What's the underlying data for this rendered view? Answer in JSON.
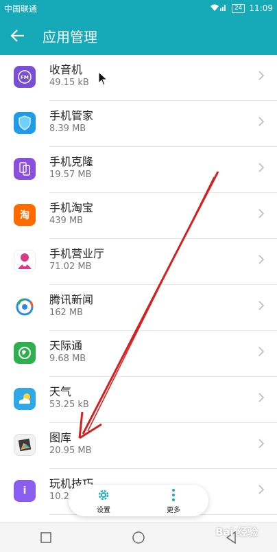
{
  "status_bar": {
    "carrier": "中国联通",
    "battery": "24",
    "time": "11:09"
  },
  "app_bar": {
    "title": "应用管理"
  },
  "apps": [
    {
      "name": "收音机",
      "size": "49.15 kB",
      "icon": "radio-fm-icon",
      "color": "#7a4fd6",
      "glyph": "FM"
    },
    {
      "name": "手机管家",
      "size": "8.39 MB",
      "icon": "shield-icon",
      "color": "#1e9be9",
      "glyph": ""
    },
    {
      "name": "手机克隆",
      "size": "19.57 MB",
      "icon": "phone-clone-icon",
      "color": "#8b4fe0",
      "glyph": ""
    },
    {
      "name": "手机淘宝",
      "size": "439 MB",
      "icon": "taobao-icon",
      "color": "#ff6a00",
      "glyph": "淘"
    },
    {
      "name": "手机营业厅",
      "size": "71.02 MB",
      "icon": "unicom-hall-icon",
      "color": "#d63c86",
      "glyph": ""
    },
    {
      "name": "腾讯新闻",
      "size": "162 MB",
      "icon": "tencent-news-icon",
      "color": "#ffffff",
      "glyph": ""
    },
    {
      "name": "天际通",
      "size": "9.68 MB",
      "icon": "globe-icon",
      "color": "#2fb04e",
      "glyph": ""
    },
    {
      "name": "天气",
      "size": "53.25 kB",
      "icon": "weather-icon",
      "color": "#2ea8e6",
      "glyph": ""
    },
    {
      "name": "图库",
      "size": "20.95 MB",
      "icon": "gallery-icon",
      "color": "#f2f2f2",
      "glyph": ""
    },
    {
      "name": "玩机技巧",
      "size": "10.2",
      "icon": "tips-icon",
      "color": "#8a5cf0",
      "glyph": "i"
    }
  ],
  "fab": {
    "settings_label": "设置",
    "more_label": "更多"
  },
  "watermark": "Bai 经验"
}
